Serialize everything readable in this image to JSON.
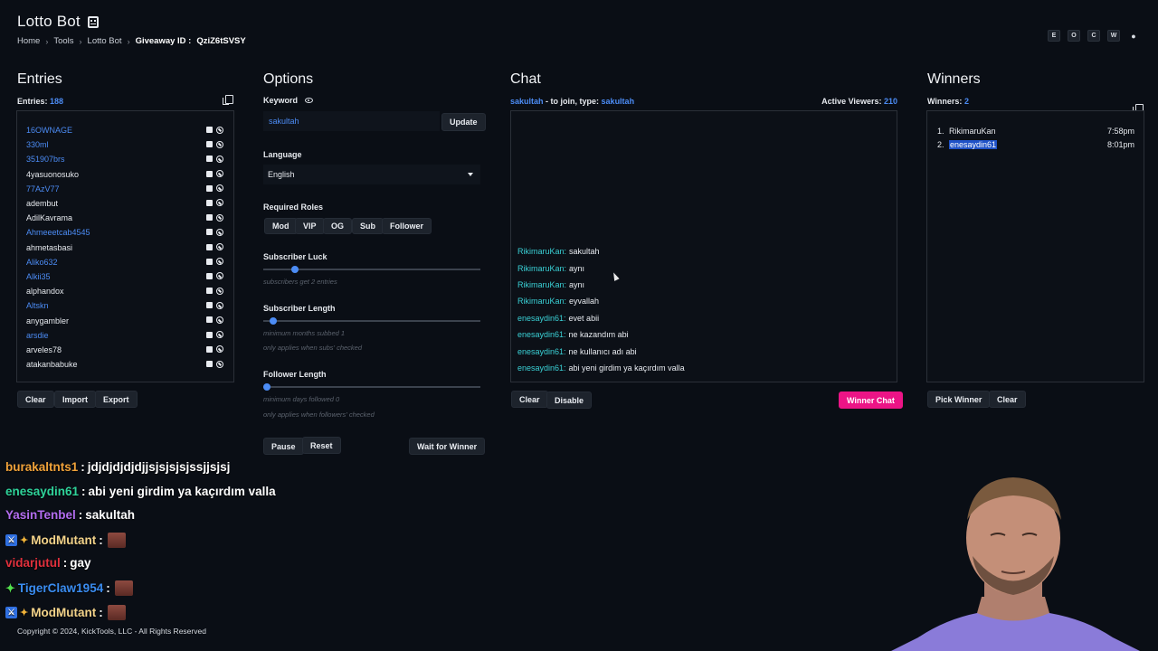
{
  "header": {
    "title": "Lotto Bot",
    "breadcrumb": [
      "Home",
      "Tools",
      "Lotto Bot"
    ],
    "giveaway_label": "Giveaway ID :",
    "giveaway_id": "QziZ6tSVSY",
    "top_icons": [
      "E",
      "O",
      "C",
      "W",
      "●"
    ]
  },
  "entries": {
    "title": "Entries",
    "count_label": "Entries:",
    "count": "188",
    "items": [
      {
        "name": "16OWNAGE",
        "sub": true
      },
      {
        "name": "330ml",
        "sub": true
      },
      {
        "name": "351907brs",
        "sub": true
      },
      {
        "name": "4yasuonosuko",
        "sub": false
      },
      {
        "name": "77AzV77",
        "sub": true
      },
      {
        "name": "adembut",
        "sub": false
      },
      {
        "name": "AdilKavrama",
        "sub": false
      },
      {
        "name": "Ahmeeetcab4545",
        "sub": true
      },
      {
        "name": "ahmetasbasi",
        "sub": false
      },
      {
        "name": "Aliko632",
        "sub": true
      },
      {
        "name": "Alkii35",
        "sub": true
      },
      {
        "name": "alphandox",
        "sub": false
      },
      {
        "name": "Altskn",
        "sub": true
      },
      {
        "name": "anygambler",
        "sub": false
      },
      {
        "name": "arsdie",
        "sub": true
      },
      {
        "name": "arveles78",
        "sub": false
      },
      {
        "name": "atakanbabuke",
        "sub": false
      }
    ],
    "buttons": {
      "clear": "Clear",
      "import": "Import",
      "export": "Export"
    }
  },
  "options": {
    "title": "Options",
    "keyword_label": "Keyword",
    "keyword_value": "sakultah",
    "update_label": "Update",
    "language_label": "Language",
    "language_value": "English",
    "roles_label": "Required Roles",
    "roles": [
      "Mod",
      "VIP",
      "OG",
      "Sub",
      "Follower"
    ],
    "sub_luck_label": "Subscriber Luck",
    "sub_luck_hint": "subscribers get 2 entries",
    "sub_luck_level": 0.13,
    "sub_length_label": "Subscriber Length",
    "sub_length_hint1": "minimum months subbed 1",
    "sub_length_hint2": "only applies when subs' checked",
    "sub_length_level": 0.03,
    "follower_length_label": "Follower Length",
    "follower_length_hint1": "minimum days followed 0",
    "follower_length_hint2": "only applies when followers' checked",
    "follower_length_level": 0.0,
    "pause_label": "Pause",
    "reset_label": "Reset",
    "wait_label": "Wait for Winner"
  },
  "chat": {
    "title": "Chat",
    "join_user": "sakultah",
    "join_text": "- to join, type:",
    "join_keyword": "sakultah",
    "viewers_label": "Active Viewers:",
    "viewers": "210",
    "messages": [
      {
        "user": "RikimaruKan:",
        "text": "sakultah"
      },
      {
        "user": "RikimaruKan:",
        "text": "aynı"
      },
      {
        "user": "RikimaruKan:",
        "text": "aynı"
      },
      {
        "user": "RikimaruKan:",
        "text": "eyvallah"
      },
      {
        "user": "enesaydin61:",
        "text": "evet abii"
      },
      {
        "user": "enesaydin61:",
        "text": "ne kazandım abi"
      },
      {
        "user": "enesaydin61:",
        "text": "ne kullanıcı adı abi"
      },
      {
        "user": "enesaydin61:",
        "text": "abi yeni girdim ya kaçırdım valla"
      }
    ],
    "clear_label": "Clear",
    "disable_label": "Disable",
    "winner_chat_label": "Winner Chat"
  },
  "winners": {
    "title": "Winners",
    "count_label": "Winners:",
    "count": "2",
    "items": [
      {
        "n": "1.",
        "name": "RikimaruKan",
        "time": "7:58pm"
      },
      {
        "n": "2.",
        "name": "enesaydin61",
        "time": "8:01pm"
      }
    ],
    "pick_label": "Pick Winner",
    "clear_label": "Clear"
  },
  "overlay_chat": [
    {
      "user": "burakaltnts1",
      "sep": ":",
      "text": "jdjdjdjdjdjjsjsjsjsjssjjsjsj",
      "color": "#f0a23a"
    },
    {
      "user": "enesaydin61",
      "sep": ":",
      "text": "abi yeni girdim ya kaçırdım valla",
      "color": "#2fd39a"
    },
    {
      "user": "YasinTenbel",
      "sep": ":",
      "text": "sakultah",
      "color": "#b36df0"
    },
    {
      "user": "ModMutant",
      "sep": ":",
      "text": "",
      "color": "#f3d38a"
    },
    {
      "user": "vidarjutul",
      "sep": ":",
      "text": "gay",
      "color": "#e0303c"
    },
    {
      "user": "TigerClaw1954",
      "sep": ":",
      "text": "",
      "color": "#3a8cf0"
    },
    {
      "user": "ModMutant",
      "sep": ":",
      "text": "",
      "color": "#f3d38a"
    }
  ],
  "footer": "Copyright © 2024, KickTools, LLC - All Rights Reserved"
}
